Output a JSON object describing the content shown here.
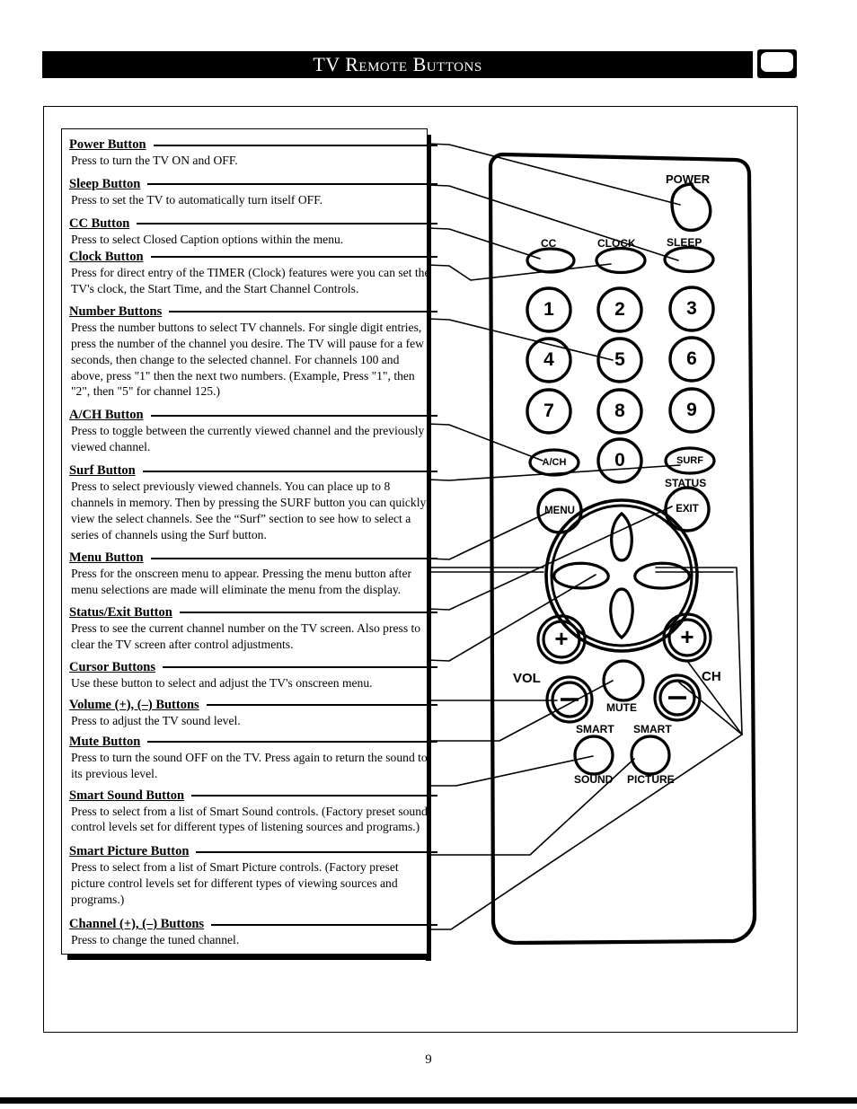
{
  "header": {
    "title": "TV Remote Buttons",
    "tv_icon": "tv-screen-icon"
  },
  "page_number": "9",
  "entries": [
    {
      "id": "power",
      "heading": "Power Button",
      "body": "Press to turn the TV ON and OFF."
    },
    {
      "id": "sleep",
      "heading": "Sleep Button",
      "body": "Press to set the TV to automatically turn itself OFF."
    },
    {
      "id": "cc",
      "heading": "CC Button",
      "body": "Press to select Closed Caption options within the menu."
    },
    {
      "id": "clock",
      "heading": "Clock Button",
      "body": "Press for direct entry of the TIMER (Clock) features were you can set the TV's clock, the Start Time, and the Start Channel Controls."
    },
    {
      "id": "number",
      "heading": "Number Buttons",
      "body": "Press the number buttons to select TV channels. For single digit entries, press the number of the channel you desire. The TV will pause for a few seconds, then change to the selected channel. For channels 100 and above, press \"1\" then the next two numbers. (Example, Press \"1\", then \"2\", then \"5\" for channel 125.)"
    },
    {
      "id": "ach",
      "heading": "A/CH Button",
      "body": "Press to toggle between the currently viewed channel and the previously viewed channel."
    },
    {
      "id": "surf",
      "heading": "Surf Button",
      "body": "Press to select previously viewed channels. You can place up to 8 channels in memory. Then by pressing the SURF button you can quickly view the select channels. See the “Surf” section to see how to select a series of channels using the Surf button."
    },
    {
      "id": "menu",
      "heading": "Menu Button",
      "body": "Press for the onscreen menu to appear. Pressing the menu button after menu selections are made will eliminate the menu from the display."
    },
    {
      "id": "status-exit",
      "heading": "Status/Exit Button",
      "body": "Press to see the current channel number on the TV screen. Also press to clear the TV screen after control adjustments."
    },
    {
      "id": "cursor",
      "heading": "Cursor Buttons",
      "body": "Use these button to select and adjust the TV's onscreen menu."
    },
    {
      "id": "volume",
      "heading": "Volume (+), (–) Buttons",
      "body": "Press to adjust the TV sound level."
    },
    {
      "id": "mute",
      "heading": "Mute Button",
      "body": "Press to turn the sound OFF on the TV. Press again to return the sound to its previous level."
    },
    {
      "id": "smart-sound",
      "heading": "Smart Sound Button",
      "body": "Press to select from a list of Smart Sound controls. (Factory preset sound control levels set for different types of listening sources and programs.)"
    },
    {
      "id": "smart-picture",
      "heading": "Smart Picture Button",
      "body": "Press to select from a list of Smart Picture controls. (Factory preset picture control levels set for different types of viewing sources and programs.)"
    },
    {
      "id": "channel",
      "heading": "Channel (+), (–) Buttons",
      "body": "Press to change the tuned channel."
    }
  ],
  "remote": {
    "labels": {
      "power": "POWER",
      "cc": "CC",
      "clock": "CLOCK",
      "sleep": "SLEEP",
      "n1": "1",
      "n2": "2",
      "n3": "3",
      "n4": "4",
      "n5": "5",
      "n6": "6",
      "n7": "7",
      "n8": "8",
      "n9": "9",
      "n0": "0",
      "ach": "A/CH",
      "surf": "SURF",
      "status": "STATUS",
      "menu": "MENU",
      "exit": "EXIT",
      "vol": "VOL",
      "ch": "CH",
      "mute": "MUTE",
      "smart_sound_1": "SMART",
      "smart_sound_2": "SOUND",
      "smart_picture_1": "SMART",
      "smart_picture_2": "PICTURE",
      "vol_plus": "+",
      "ch_plus": "+"
    }
  },
  "colors": {
    "ink": "#000000",
    "paper": "#ffffff"
  }
}
